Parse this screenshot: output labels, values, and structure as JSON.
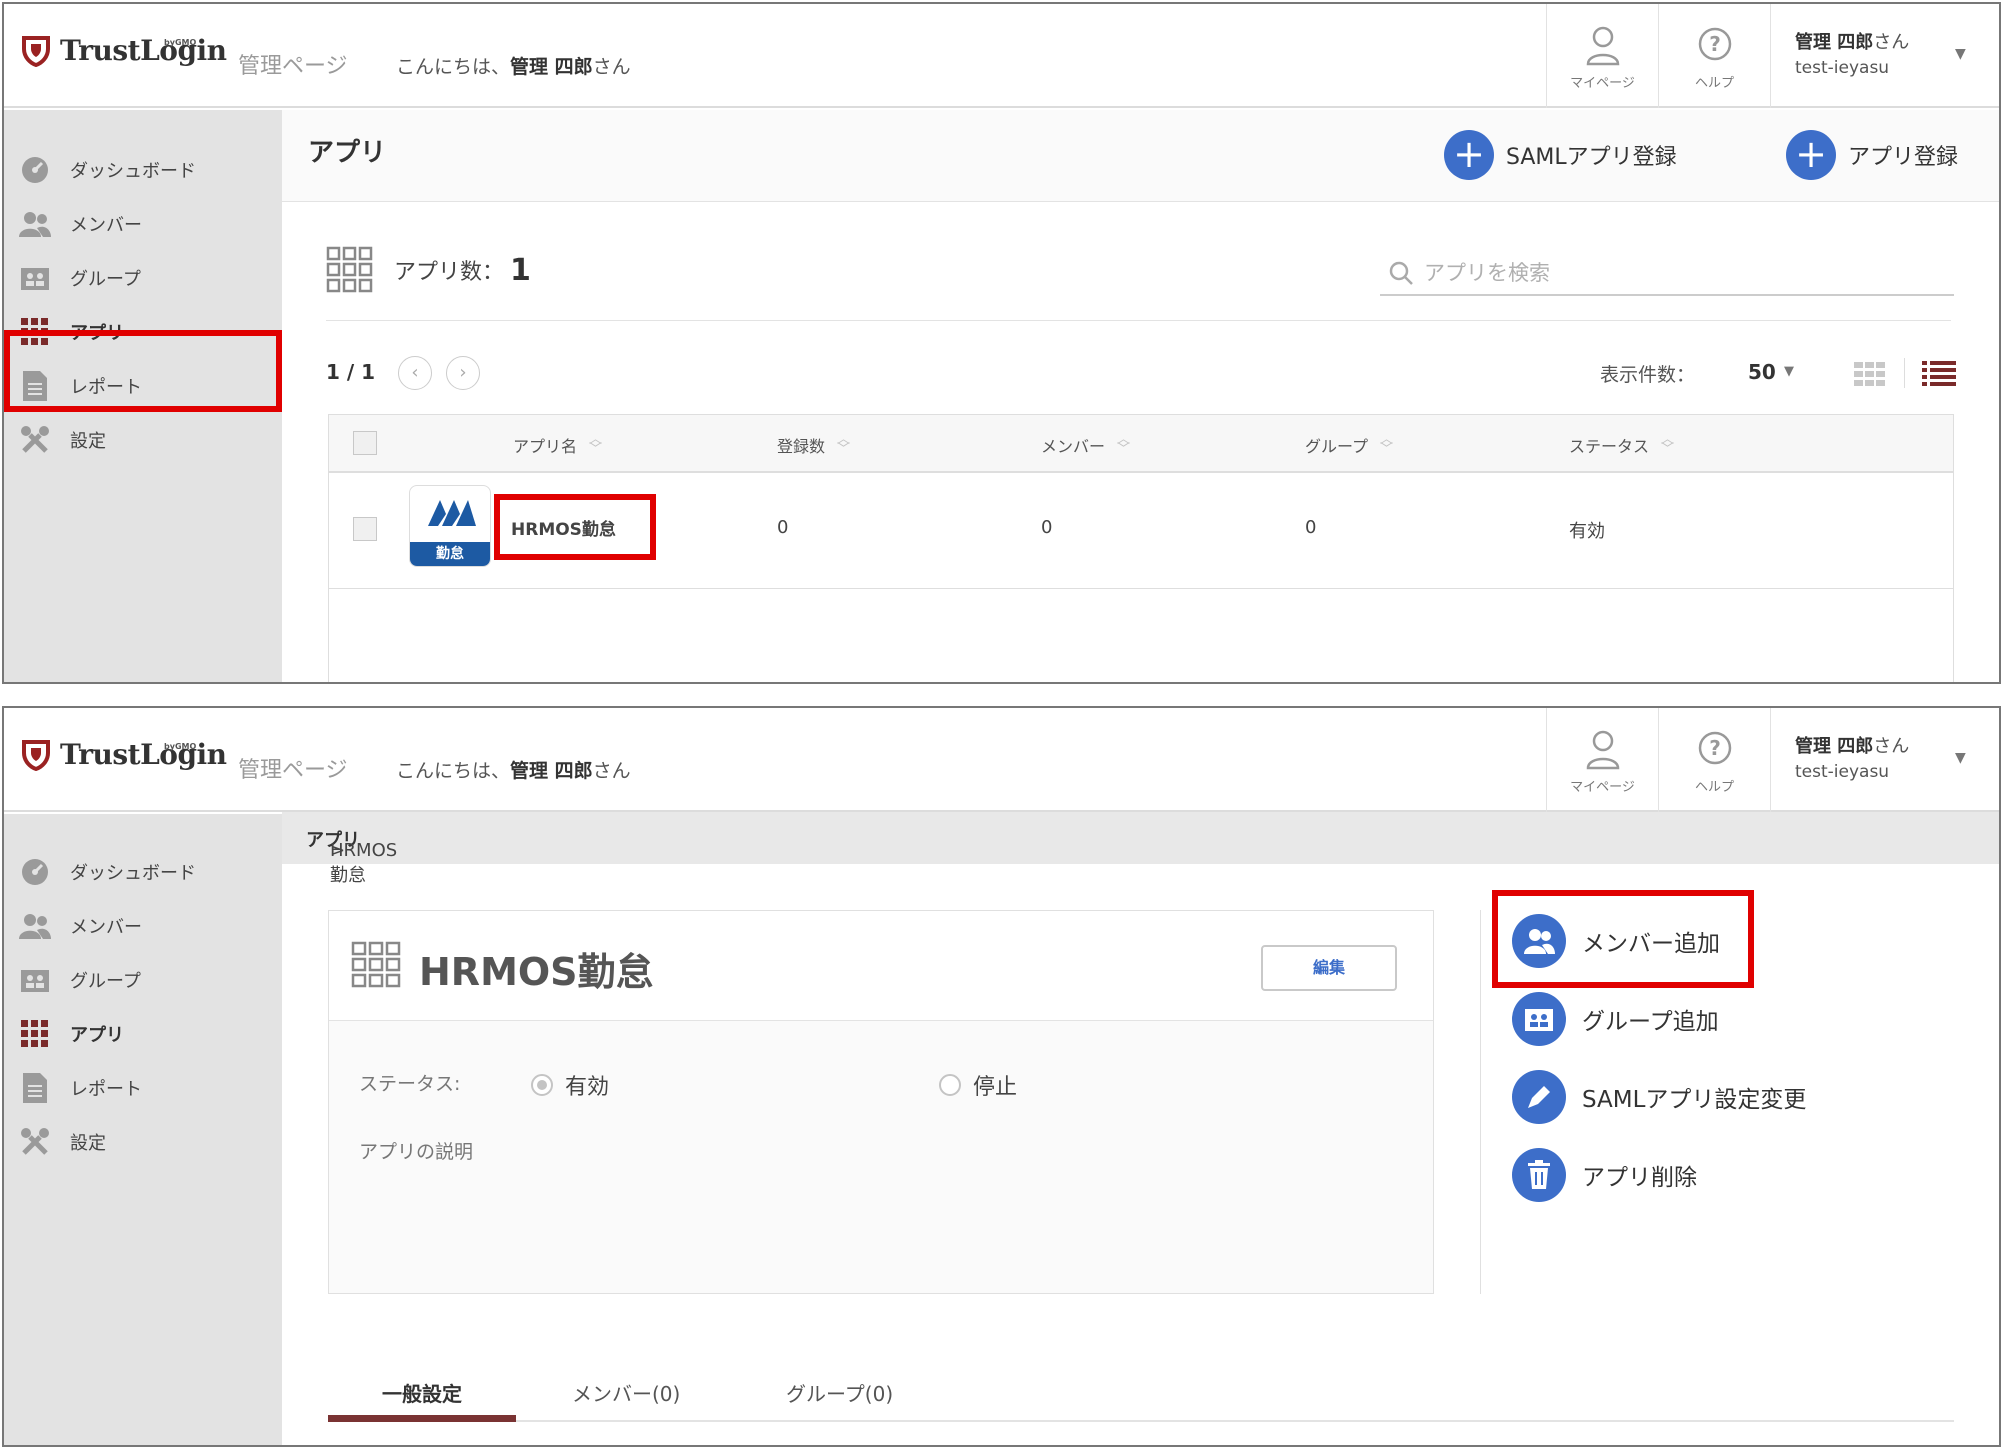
{
  "brand": {
    "name": "TrustLogin",
    "by": "byGMO",
    "admin_label": "管理ページ",
    "greeting_prefix": "こんにちは、",
    "greeting_name": "管理 四郎",
    "greeting_suffix": "さん"
  },
  "header": {
    "mypage": "マイページ",
    "help": "ヘルプ",
    "user_name": "管理 四郎",
    "user_suffix": "さん",
    "user_id": "test-ieyasu"
  },
  "sidebar": {
    "items": [
      {
        "label": "ダッシュボード",
        "icon": "dashboard-icon"
      },
      {
        "label": "メンバー",
        "icon": "members-icon"
      },
      {
        "label": "グループ",
        "icon": "group-icon"
      },
      {
        "label": "アプリ",
        "icon": "apps-grid-icon"
      },
      {
        "label": "レポート",
        "icon": "report-icon"
      },
      {
        "label": "設定",
        "icon": "settings-icon"
      }
    ],
    "active": "アプリ"
  },
  "apps_page": {
    "title": "アプリ",
    "saml_register": "SAMLアプリ登録",
    "app_register": "アプリ登録",
    "count_label": "アプリ数：",
    "count_value": "1",
    "search_placeholder": "アプリを検索",
    "pager": "1 / 1",
    "per_page_label": "表示件数：",
    "per_page_value": "50",
    "columns": [
      "アプリ名",
      "登録数",
      "メンバー",
      "グループ",
      "ステータス"
    ],
    "rows": [
      {
        "logo_text": "勤怠",
        "name": "HRMOS勤怠",
        "registered": "0",
        "members": "0",
        "groups": "0",
        "status": "有効"
      }
    ]
  },
  "detail_page": {
    "breadcrumb_root": "アプリ",
    "breadcrumb_sep": " >",
    "breadcrumb_leaf": "HRMOS勤怠",
    "app_name": "HRMOS勤怠",
    "edit": "編集",
    "status_label": "ステータス:",
    "status_on": "有効",
    "status_off": "停止",
    "description_label": "アプリの説明",
    "actions": [
      {
        "label": "メンバー追加",
        "icon": "add-member-icon"
      },
      {
        "label": "グループ追加",
        "icon": "add-group-icon"
      },
      {
        "label": "SAMLアプリ設定変更",
        "icon": "edit-pencil-icon"
      },
      {
        "label": "アプリ削除",
        "icon": "trash-icon"
      }
    ],
    "tabs": [
      "一般設定",
      "メンバー(0)",
      "グループ(0)"
    ]
  },
  "colors": {
    "accent_blue": "#3d6ec9",
    "brand_maroon": "#7a3333",
    "highlight_red": "#e00000",
    "sidebar_bg": "#e3e3e3"
  }
}
